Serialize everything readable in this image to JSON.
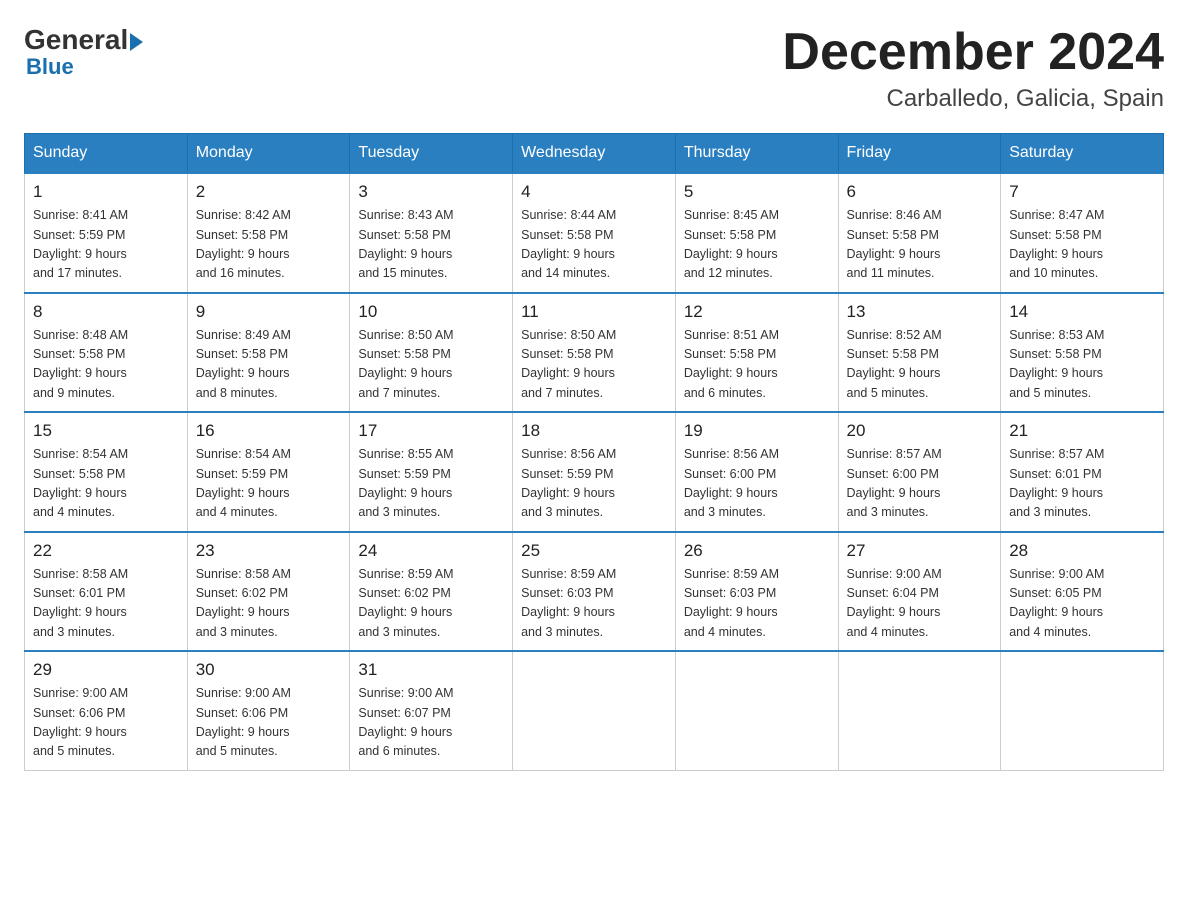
{
  "logo": {
    "general": "General",
    "blue": "Blue",
    "arrow": "▶"
  },
  "title": "December 2024",
  "location": "Carballedo, Galicia, Spain",
  "days_of_week": [
    "Sunday",
    "Monday",
    "Tuesday",
    "Wednesday",
    "Thursday",
    "Friday",
    "Saturday"
  ],
  "weeks": [
    [
      {
        "day": "1",
        "info": "Sunrise: 8:41 AM\nSunset: 5:59 PM\nDaylight: 9 hours\nand 17 minutes."
      },
      {
        "day": "2",
        "info": "Sunrise: 8:42 AM\nSunset: 5:58 PM\nDaylight: 9 hours\nand 16 minutes."
      },
      {
        "day": "3",
        "info": "Sunrise: 8:43 AM\nSunset: 5:58 PM\nDaylight: 9 hours\nand 15 minutes."
      },
      {
        "day": "4",
        "info": "Sunrise: 8:44 AM\nSunset: 5:58 PM\nDaylight: 9 hours\nand 14 minutes."
      },
      {
        "day": "5",
        "info": "Sunrise: 8:45 AM\nSunset: 5:58 PM\nDaylight: 9 hours\nand 12 minutes."
      },
      {
        "day": "6",
        "info": "Sunrise: 8:46 AM\nSunset: 5:58 PM\nDaylight: 9 hours\nand 11 minutes."
      },
      {
        "day": "7",
        "info": "Sunrise: 8:47 AM\nSunset: 5:58 PM\nDaylight: 9 hours\nand 10 minutes."
      }
    ],
    [
      {
        "day": "8",
        "info": "Sunrise: 8:48 AM\nSunset: 5:58 PM\nDaylight: 9 hours\nand 9 minutes."
      },
      {
        "day": "9",
        "info": "Sunrise: 8:49 AM\nSunset: 5:58 PM\nDaylight: 9 hours\nand 8 minutes."
      },
      {
        "day": "10",
        "info": "Sunrise: 8:50 AM\nSunset: 5:58 PM\nDaylight: 9 hours\nand 7 minutes."
      },
      {
        "day": "11",
        "info": "Sunrise: 8:50 AM\nSunset: 5:58 PM\nDaylight: 9 hours\nand 7 minutes."
      },
      {
        "day": "12",
        "info": "Sunrise: 8:51 AM\nSunset: 5:58 PM\nDaylight: 9 hours\nand 6 minutes."
      },
      {
        "day": "13",
        "info": "Sunrise: 8:52 AM\nSunset: 5:58 PM\nDaylight: 9 hours\nand 5 minutes."
      },
      {
        "day": "14",
        "info": "Sunrise: 8:53 AM\nSunset: 5:58 PM\nDaylight: 9 hours\nand 5 minutes."
      }
    ],
    [
      {
        "day": "15",
        "info": "Sunrise: 8:54 AM\nSunset: 5:58 PM\nDaylight: 9 hours\nand 4 minutes."
      },
      {
        "day": "16",
        "info": "Sunrise: 8:54 AM\nSunset: 5:59 PM\nDaylight: 9 hours\nand 4 minutes."
      },
      {
        "day": "17",
        "info": "Sunrise: 8:55 AM\nSunset: 5:59 PM\nDaylight: 9 hours\nand 3 minutes."
      },
      {
        "day": "18",
        "info": "Sunrise: 8:56 AM\nSunset: 5:59 PM\nDaylight: 9 hours\nand 3 minutes."
      },
      {
        "day": "19",
        "info": "Sunrise: 8:56 AM\nSunset: 6:00 PM\nDaylight: 9 hours\nand 3 minutes."
      },
      {
        "day": "20",
        "info": "Sunrise: 8:57 AM\nSunset: 6:00 PM\nDaylight: 9 hours\nand 3 minutes."
      },
      {
        "day": "21",
        "info": "Sunrise: 8:57 AM\nSunset: 6:01 PM\nDaylight: 9 hours\nand 3 minutes."
      }
    ],
    [
      {
        "day": "22",
        "info": "Sunrise: 8:58 AM\nSunset: 6:01 PM\nDaylight: 9 hours\nand 3 minutes."
      },
      {
        "day": "23",
        "info": "Sunrise: 8:58 AM\nSunset: 6:02 PM\nDaylight: 9 hours\nand 3 minutes."
      },
      {
        "day": "24",
        "info": "Sunrise: 8:59 AM\nSunset: 6:02 PM\nDaylight: 9 hours\nand 3 minutes."
      },
      {
        "day": "25",
        "info": "Sunrise: 8:59 AM\nSunset: 6:03 PM\nDaylight: 9 hours\nand 3 minutes."
      },
      {
        "day": "26",
        "info": "Sunrise: 8:59 AM\nSunset: 6:03 PM\nDaylight: 9 hours\nand 4 minutes."
      },
      {
        "day": "27",
        "info": "Sunrise: 9:00 AM\nSunset: 6:04 PM\nDaylight: 9 hours\nand 4 minutes."
      },
      {
        "day": "28",
        "info": "Sunrise: 9:00 AM\nSunset: 6:05 PM\nDaylight: 9 hours\nand 4 minutes."
      }
    ],
    [
      {
        "day": "29",
        "info": "Sunrise: 9:00 AM\nSunset: 6:06 PM\nDaylight: 9 hours\nand 5 minutes."
      },
      {
        "day": "30",
        "info": "Sunrise: 9:00 AM\nSunset: 6:06 PM\nDaylight: 9 hours\nand 5 minutes."
      },
      {
        "day": "31",
        "info": "Sunrise: 9:00 AM\nSunset: 6:07 PM\nDaylight: 9 hours\nand 6 minutes."
      },
      {
        "day": "",
        "info": ""
      },
      {
        "day": "",
        "info": ""
      },
      {
        "day": "",
        "info": ""
      },
      {
        "day": "",
        "info": ""
      }
    ]
  ]
}
